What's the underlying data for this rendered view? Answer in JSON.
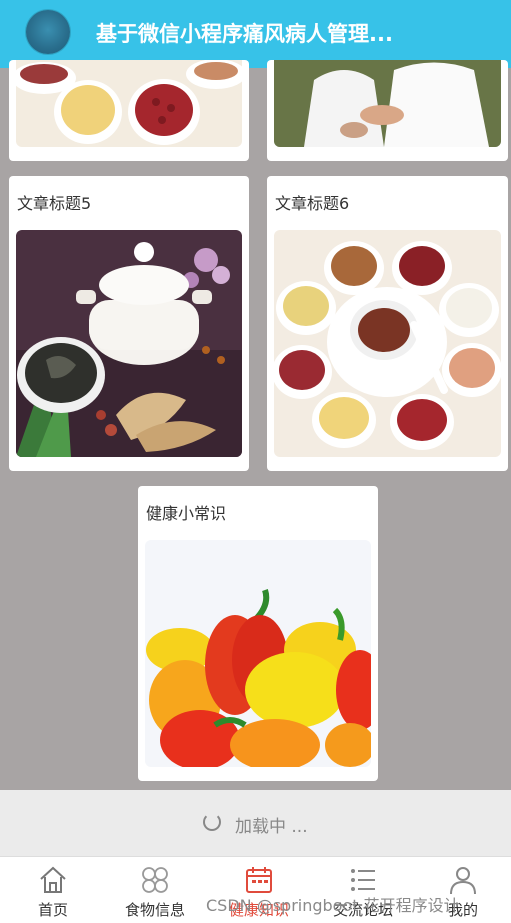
{
  "header": {
    "title": "基于微信小程序痛风病人管理..."
  },
  "articles": [
    {
      "title": "文章标题5"
    },
    {
      "title": "文章标题6"
    },
    {
      "title": "健康小常识"
    }
  ],
  "loading": {
    "text": "加载中 ..."
  },
  "tabbar": {
    "items": [
      {
        "label": "首页",
        "icon": "home-icon"
      },
      {
        "label": "食物信息",
        "icon": "grid-icon"
      },
      {
        "label": "健康知识",
        "icon": "calendar-icon"
      },
      {
        "label": "交流论坛",
        "icon": "list-icon"
      },
      {
        "label": "我的",
        "icon": "user-icon"
      }
    ],
    "active_index": 2
  },
  "watermark": "CSDN @springboot 花开程序设计",
  "colors": {
    "header": "#37c2e8",
    "active_tab": "#e04b3c"
  }
}
